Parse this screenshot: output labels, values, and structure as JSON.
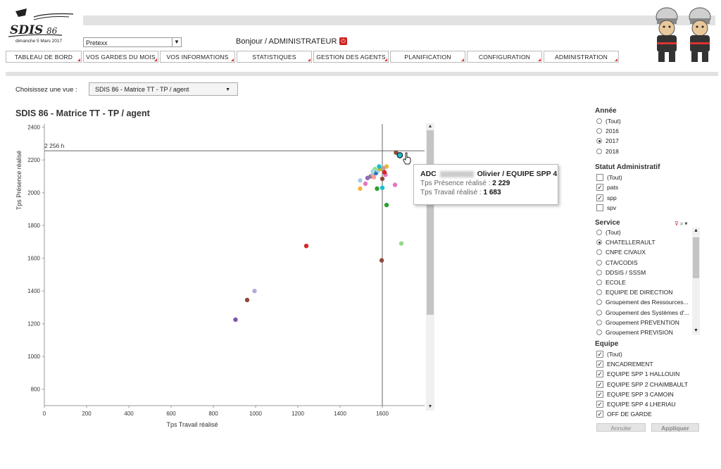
{
  "header": {
    "logo_text": "SDIS 86",
    "date": "dimanche 5 Mars 2017",
    "site_select_value": "Pretexx",
    "greeting": "Bonjour / ADMINISTRATEUR",
    "power_icon": "power-icon"
  },
  "nav": [
    "TABLEAU DE BORD",
    "VOS GARDES DU MOIS",
    "VOS INFORMATIONS",
    "STATISTIQUES",
    "GESTION DES AGENTS",
    "PLANIFICATION",
    "CONFIGURATION",
    "ADMINISTRATION"
  ],
  "view": {
    "label": "Choisissez une vue :",
    "value": "SDIS 86 - Matrice TT - TP / agent"
  },
  "chart_title": "SDIS 86 - Matrice TT - TP / agent",
  "tooltip": {
    "name_prefix": "ADC",
    "name_suffix": "Olivier / EQUIPE SPP 4",
    "presence_label": "Tps Présence réalisé :",
    "presence_value": "2 229",
    "travail_label": "Tps Travail réalisé   :",
    "travail_value": "1 683"
  },
  "chart_data": {
    "type": "scatter",
    "xlabel": "Tps Travail réalisé",
    "ylabel": "Tps Présence réalisé",
    "xlim": [
      0,
      1800
    ],
    "ylim": [
      700,
      2420
    ],
    "x_ticks": [
      0,
      200,
      400,
      600,
      800,
      1000,
      1200,
      1400,
      1600
    ],
    "y_ticks": [
      800,
      1000,
      1200,
      1400,
      1600,
      1800,
      2000,
      2200,
      2400
    ],
    "ref_line_h": {
      "value": 2256,
      "label": "2 256 h"
    },
    "ref_line_v": {
      "value": 1600
    },
    "points": [
      {
        "x": 905,
        "y": 1225,
        "color": "#7b55a8"
      },
      {
        "x": 960,
        "y": 1345,
        "color": "#8b4a3c"
      },
      {
        "x": 995,
        "y": 1400,
        "color": "#b8a8d8"
      },
      {
        "x": 1240,
        "y": 1675,
        "color": "#d62728"
      },
      {
        "x": 1597,
        "y": 1587,
        "color": "#8b4a3c"
      },
      {
        "x": 1690,
        "y": 1690,
        "color": "#98d88a"
      },
      {
        "x": 1620,
        "y": 1925,
        "color": "#2ca02c"
      },
      {
        "x": 1660,
        "y": 2048,
        "color": "#e377c2"
      },
      {
        "x": 1575,
        "y": 2025,
        "color": "#2ca02c"
      },
      {
        "x": 1600,
        "y": 2030,
        "color": "#17becf"
      },
      {
        "x": 1495,
        "y": 2025,
        "color": "#f5b342"
      },
      {
        "x": 1495,
        "y": 2075,
        "color": "#aec7e8"
      },
      {
        "x": 1520,
        "y": 2055,
        "color": "#e377c2"
      },
      {
        "x": 1530,
        "y": 2090,
        "color": "#9467bd"
      },
      {
        "x": 1545,
        "y": 2100,
        "color": "#7f7f7f"
      },
      {
        "x": 1555,
        "y": 2110,
        "color": "#c5b0d5"
      },
      {
        "x": 1560,
        "y": 2095,
        "color": "#ff9896"
      },
      {
        "x": 1570,
        "y": 2120,
        "color": "#1f77b4"
      },
      {
        "x": 1580,
        "y": 2135,
        "color": "#aec7e8"
      },
      {
        "x": 1590,
        "y": 2145,
        "color": "#bcbd22"
      },
      {
        "x": 1600,
        "y": 2085,
        "color": "#8b4a3c"
      },
      {
        "x": 1615,
        "y": 2110,
        "color": "#e377c2"
      },
      {
        "x": 1620,
        "y": 2160,
        "color": "#f5b342"
      },
      {
        "x": 1605,
        "y": 2150,
        "color": "#c49c94"
      },
      {
        "x": 1585,
        "y": 2160,
        "color": "#17becf"
      },
      {
        "x": 1565,
        "y": 2145,
        "color": "#98df8a"
      },
      {
        "x": 1555,
        "y": 2130,
        "color": "#9edae5"
      },
      {
        "x": 1610,
        "y": 2125,
        "color": "#d62728"
      },
      {
        "x": 1665,
        "y": 2245,
        "color": "#8b4a3c"
      },
      {
        "x": 1683,
        "y": 2229,
        "color": "#17becf"
      }
    ]
  },
  "filters": {
    "annee": {
      "title": "Année",
      "options": [
        "(Tout)",
        "2016",
        "2017",
        "2018"
      ],
      "selected": "2017"
    },
    "statut": {
      "title": "Statut Administratif",
      "options": [
        {
          "label": "(Tout)",
          "checked": false
        },
        {
          "label": "pats",
          "checked": true
        },
        {
          "label": "spp",
          "checked": true
        },
        {
          "label": "spv",
          "checked": false
        }
      ]
    },
    "service": {
      "title": "Service",
      "options": [
        "(Tout)",
        "CHATELLERAULT",
        "CNPE CIVAUX",
        "CTA/CODIS",
        "DDSIS / SSSM",
        "ECOLE",
        "EQUIPE DE DIRECTION",
        "Groupement des Ressources...",
        "Groupement des Systèmes d'...",
        "Groupement PREVENTION",
        "Groupement PREVISION"
      ],
      "selected": "CHATELLERAULT"
    },
    "equipe": {
      "title": "Equipe",
      "options": [
        {
          "label": "(Tout)",
          "checked": true
        },
        {
          "label": "ENCADREMENT",
          "checked": true
        },
        {
          "label": "EQUIPE SPP 1 HALLOUIN",
          "checked": true
        },
        {
          "label": "EQUIPE SPP 2 CHAIMBAULT",
          "checked": true
        },
        {
          "label": "EQUIPE SPP 3 CAMOIN",
          "checked": true
        },
        {
          "label": "EQUIPE SPP 4 LHERIAU",
          "checked": true
        },
        {
          "label": "OFF DE GARDE",
          "checked": true
        }
      ]
    },
    "cancel_label": "Annuler",
    "apply_label": "Appliquer"
  }
}
